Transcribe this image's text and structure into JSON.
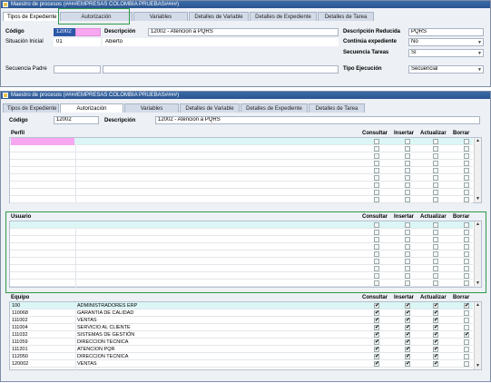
{
  "back_window": {
    "title": "Maestro de procesos (####EMPRESAS COLOMBIA PRUEBAS####)",
    "tabs": [
      "Tipos de Expediente",
      "Autorización",
      "Variables",
      "Detalles de Variable",
      "Detalles de Expediente",
      "Detalles de Tarea"
    ],
    "fields": {
      "codigo_label": "Código",
      "codigo_value": "12002",
      "descripcion_label": "Descripción",
      "descripcion_value": "12002 - Atencion a PQRS",
      "desc_reducida_label": "Descripción Reducida",
      "desc_reducida_value": "PQRS",
      "situacion_label": "Situación Inicial",
      "situacion_code": "01",
      "situacion_value": "Abierto",
      "continua_label": "Continúa expediente",
      "continua_value": "No",
      "secuencia_tareas_label": "Secuencia Tareas",
      "secuencia_tareas_value": "Sí",
      "secuencia_padre_label": "Secuencia Padre",
      "tipo_ejecucion_label": "Tipo Ejecución",
      "tipo_ejecucion_value": "Secuencial"
    }
  },
  "front_window": {
    "title": "Maestro de procesos (####EMPRESAS COLOMBIA PRUEBAS####)",
    "tabs": [
      "Tipos de Expediente",
      "Autorización",
      "Variables",
      "Detalles de Variable",
      "Detalles de Expediente",
      "Detalles de Tarea"
    ],
    "active_tab": "Autorización",
    "codigo_label": "Código",
    "codigo_value": "12002",
    "descripcion_label": "Descripción",
    "descripcion_value": "12002 - Atencion a PQRS",
    "perm_headers": [
      "Consultar",
      "Insertar",
      "Actualizar",
      "Borrar"
    ],
    "perfil": {
      "title": "Perfil"
    },
    "usuario": {
      "title": "Usuario"
    },
    "equipo": {
      "title": "Equipo",
      "rows": [
        {
          "code": "100",
          "name": "ADMINISTRADORES ERP",
          "perms": [
            true,
            true,
            true,
            true
          ]
        },
        {
          "code": "110068",
          "name": "GARANTIA DE CALIDAD",
          "perms": [
            true,
            true,
            true,
            false
          ]
        },
        {
          "code": "111002",
          "name": "VENTAS",
          "perms": [
            true,
            true,
            true,
            false
          ]
        },
        {
          "code": "111004",
          "name": "SERVICIO AL CLIENTE",
          "perms": [
            true,
            true,
            true,
            false
          ]
        },
        {
          "code": "111032",
          "name": "SISTEMAS DE GESTIÓN",
          "perms": [
            true,
            true,
            true,
            true
          ]
        },
        {
          "code": "111059",
          "name": "DIRECCION TECNICA",
          "perms": [
            true,
            true,
            true,
            false
          ]
        },
        {
          "code": "111201",
          "name": "ATENCION PQR",
          "perms": [
            true,
            true,
            true,
            false
          ]
        },
        {
          "code": "112050",
          "name": "DIRECCION TECNICA",
          "perms": [
            true,
            true,
            true,
            false
          ]
        },
        {
          "code": "120002",
          "name": "VENTAS",
          "perms": [
            true,
            true,
            true,
            false
          ]
        }
      ]
    }
  },
  "colors": {
    "title_bar": "#2a5590",
    "selection": "#dcf6f6",
    "pink_field": "#f7a8f0",
    "highlight": "#2e9a4a"
  }
}
